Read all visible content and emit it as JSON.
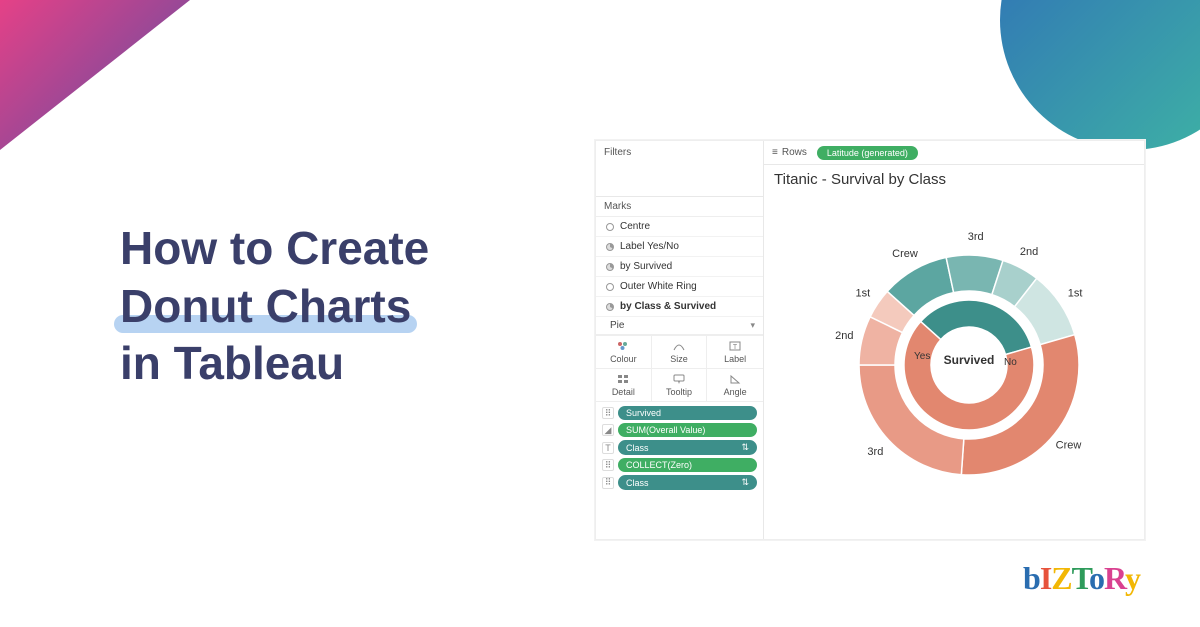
{
  "headline": {
    "l1": "How to Create",
    "l2": "Donut Charts",
    "l3": "in Tableau"
  },
  "tableau": {
    "filters_label": "Filters",
    "marks_label": "Marks",
    "mark_layers": [
      "Centre",
      "Label Yes/No",
      "by Survived",
      "Outer White Ring",
      "by Class & Survived"
    ],
    "mark_type": "Pie",
    "buttons_row1": [
      "Colour",
      "Size",
      "Label"
    ],
    "buttons_row2": [
      "Detail",
      "Tooltip",
      "Angle"
    ],
    "pills": [
      {
        "icon": "colour",
        "text": "Survived",
        "cls": ""
      },
      {
        "icon": "angle",
        "text": "SUM(Overall Value)",
        "cls": "green"
      },
      {
        "icon": "label",
        "text": "Class",
        "cls": ""
      },
      {
        "icon": "detail",
        "text": "COLLECT(Zero)",
        "cls": "green"
      },
      {
        "icon": "colour",
        "text": "Class",
        "cls": ""
      }
    ],
    "rows_label": "Rows",
    "rows_pill": "Latitude (generated)",
    "viz_title": "Titanic - Survival by Class",
    "center_label": "Survived",
    "inner_labels": {
      "yes": "Yes",
      "no": "No"
    },
    "outer_labels": [
      "1st",
      "2nd",
      "3rd",
      "Crew",
      "1st",
      "2nd",
      "3rd",
      "Crew"
    ]
  },
  "logo": [
    "b",
    "I",
    "z",
    "T",
    "o",
    "R",
    "y"
  ],
  "chart_data": {
    "type": "pie",
    "title": "Titanic - Survival by Class",
    "note": "Nested donut; inner ring by Survived, outer ring by Class within Survived. Angular spans estimated from image.",
    "inner": [
      {
        "name": "Yes",
        "angle_deg": 122,
        "color": "#3d8f8a"
      },
      {
        "name": "No",
        "angle_deg": 238,
        "color": "#e2876f"
      }
    ],
    "outer": [
      {
        "survived": "Yes",
        "class": "Crew",
        "angle_deg": 36,
        "color": "#5ca6a1"
      },
      {
        "survived": "Yes",
        "class": "3rd",
        "angle_deg": 30,
        "color": "#79b6b1"
      },
      {
        "survived": "Yes",
        "class": "2nd",
        "angle_deg": 20,
        "color": "#a8d0cc"
      },
      {
        "survived": "Yes",
        "class": "1st",
        "angle_deg": 36,
        "color": "#cfe5e2"
      },
      {
        "survived": "No",
        "class": "Crew",
        "angle_deg": 110,
        "color": "#e2876f"
      },
      {
        "survived": "No",
        "class": "3rd",
        "angle_deg": 86,
        "color": "#e89a86"
      },
      {
        "survived": "No",
        "class": "2nd",
        "angle_deg": 26,
        "color": "#efb3a3"
      },
      {
        "survived": "No",
        "class": "1st",
        "angle_deg": 16,
        "color": "#f4cabd"
      }
    ]
  }
}
